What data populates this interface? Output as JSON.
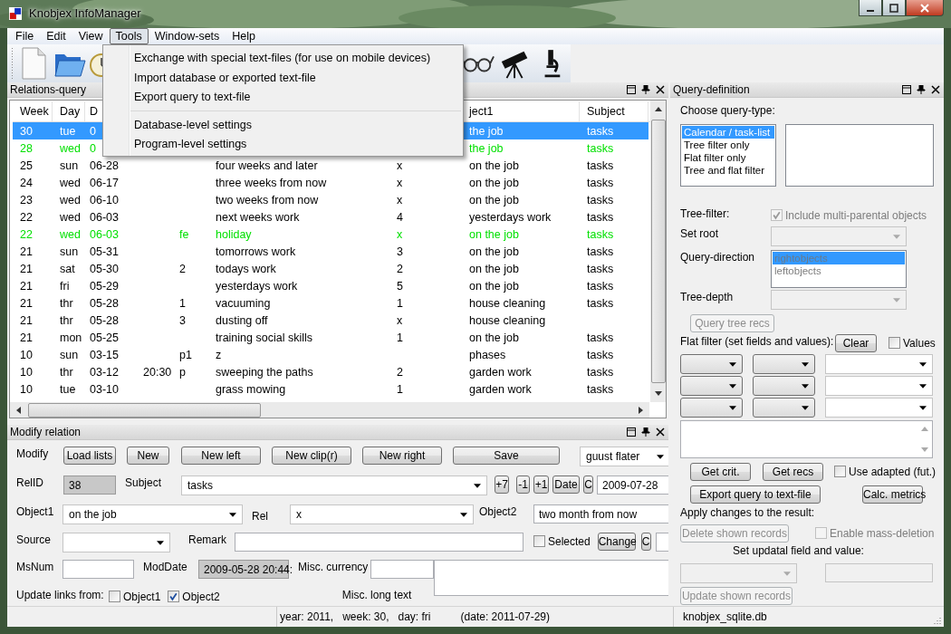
{
  "window": {
    "title": "Knobjex InfoManager"
  },
  "menu": [
    {
      "label": "File",
      "selected": false
    },
    {
      "label": "Edit",
      "selected": false
    },
    {
      "label": "View",
      "selected": false
    },
    {
      "label": "Tools",
      "selected": true
    },
    {
      "label": "Window-sets",
      "selected": false
    },
    {
      "label": "Help",
      "selected": false
    }
  ],
  "tools_menu": {
    "groups": [
      [
        "Exchange with special text-files (for use on mobile devices)",
        "Import database or exported text-file",
        "Export query to text-file"
      ],
      [
        "Database-level settings",
        "Program-level settings"
      ]
    ]
  },
  "relations_query": {
    "title": "Relations-query",
    "headers": {
      "week": "Week",
      "day": "Day",
      "date": "D",
      "object1": "ject1",
      "subject": "Subject"
    },
    "rows": [
      {
        "selected": true,
        "week": "30",
        "day": "tue",
        "date": "0",
        "object1": "the job",
        "subject": "tasks"
      },
      {
        "selected": false,
        "color": "#00e000",
        "week": "28",
        "day": "wed",
        "date": "0",
        "object1": "the job",
        "subject": "tasks"
      },
      {
        "selected": false,
        "color": "#000000",
        "week": "25",
        "day": "sun",
        "date": "06-28",
        "column_6": "four weeks and later",
        "column_7": "x",
        "object1": "on the job",
        "subject": "tasks"
      },
      {
        "selected": false,
        "color": "#000000",
        "week": "24",
        "day": "wed",
        "date": "06-17",
        "column_6": "three weeks from now",
        "column_7": "x",
        "object1": "on the job",
        "subject": "tasks"
      },
      {
        "selected": false,
        "color": "#000000",
        "week": "23",
        "day": "wed",
        "date": "06-10",
        "column_6": "two weeks from now",
        "column_7": "x",
        "object1": "on the job",
        "subject": "tasks"
      },
      {
        "selected": false,
        "color": "#000000",
        "week": "22",
        "day": "wed",
        "date": "06-03",
        "column_6": "next weeks work",
        "column_7": "4",
        "object1": "yesterdays work",
        "subject": "tasks"
      },
      {
        "selected": false,
        "color": "#00e000",
        "week": "22",
        "day": "wed",
        "date": "06-03",
        "column_5": "fe",
        "column_6": "holiday",
        "column_7": "x",
        "object1": "on the job",
        "subject": "tasks"
      },
      {
        "selected": false,
        "color": "#000000",
        "week": "21",
        "day": "sun",
        "date": "05-31",
        "column_6": "tomorrows work",
        "column_7": "3",
        "object1": "on the job",
        "subject": "tasks"
      },
      {
        "selected": false,
        "color": "#000000",
        "week": "21",
        "day": "sat",
        "date": "05-30",
        "column_5": "2",
        "column_6": "todays work",
        "column_7": "2",
        "object1": "on the job",
        "subject": "tasks"
      },
      {
        "selected": false,
        "color": "#000000",
        "week": "21",
        "day": "fri",
        "date": "05-29",
        "column_6": "yesterdays work",
        "column_7": "5",
        "object1": "on the job",
        "subject": "tasks"
      },
      {
        "selected": false,
        "color": "#000000",
        "week": "21",
        "day": "thr",
        "date": "05-28",
        "column_5": "1",
        "column_6": "vacuuming",
        "column_7": "1",
        "object1": "house cleaning",
        "subject": "tasks"
      },
      {
        "selected": false,
        "color": "#000000",
        "week": "21",
        "day": "thr",
        "date": "05-28",
        "column_5": "3",
        "column_6": "dusting off",
        "column_7": "x",
        "object1": "house cleaning"
      },
      {
        "selected": false,
        "color": "#000000",
        "week": "21",
        "day": "mon",
        "date": "05-25",
        "column_6": "training social skills",
        "column_7": "1",
        "object1": "on the job",
        "subject": "tasks"
      },
      {
        "selected": false,
        "color": "#000000",
        "week": "10",
        "day": "sun",
        "date": "03-15",
        "column_5": "p1",
        "column_6": "z",
        "object1": "phases",
        "subject": "tasks"
      },
      {
        "selected": false,
        "color": "#000000",
        "week": "10",
        "day": "thr",
        "date": "03-12",
        "column_4": "20:30",
        "column_5": "p",
        "column_6": "sweeping the paths",
        "column_7": "2",
        "object1": "garden work",
        "subject": "tasks"
      },
      {
        "selected": false,
        "color": "#000000",
        "week": "10",
        "day": "tue",
        "date": "03-10",
        "column_6": "grass mowing",
        "column_7": "1",
        "object1": "garden work",
        "subject": "tasks"
      }
    ]
  },
  "modify_relation": {
    "title": "Modify relation",
    "modify_label": "Modify",
    "buttons": [
      "Load lists",
      "New",
      "New left",
      "New clip(r)",
      "New right",
      "Save"
    ],
    "user": "guust flater",
    "relid_label": "RelID",
    "relid": {
      "value": "38",
      "readonly": true
    },
    "subject_label": "Subject",
    "subject": "tasks",
    "date_buttons": [
      "+7",
      "-1",
      "+1",
      "Date",
      "C"
    ],
    "date": "2009-07-28",
    "object1_label": "Object1",
    "object1": "on the job",
    "rel_label": "Rel",
    "rel": "x",
    "object2_label": "Object2",
    "object2": "two month from now",
    "source_label": "Source",
    "remark_label": "Remark",
    "selected_check": {
      "label": "Selected",
      "checked": false
    },
    "change_buttons": [
      "Change",
      "C"
    ],
    "msnum_label": "MsNum",
    "moddate_label": "ModDate",
    "moddate": {
      "value": "2009-05-28 20:44:",
      "readonly": true
    },
    "currency_label": "Misc. currency",
    "update_links_label": "Update links from:",
    "update_links": [
      {
        "label": "Object1",
        "checked": false
      },
      {
        "label": "Object2",
        "checked": true
      }
    ],
    "long_text_label": "Misc. long text"
  },
  "query_definition": {
    "title": "Query-definition",
    "choose_label": "Choose query-type:",
    "query_types": [
      {
        "label": "Calendar / task-list",
        "selected": true
      },
      {
        "label": "Tree filter only",
        "selected": false
      },
      {
        "label": "Flat filter only",
        "selected": false
      },
      {
        "label": "Tree and flat filter",
        "selected": false
      }
    ],
    "tree_filter_label": "Tree-filter:",
    "multi_parental": {
      "label": "Include multi-parental objects",
      "checked": true,
      "disabled": true
    },
    "set_root_label": "Set root",
    "direction_label": "Query-direction",
    "directions": [
      {
        "label": "rightobjects",
        "selected": true
      },
      {
        "label": "leftobjects",
        "selected": false
      }
    ],
    "tree_depth_label": "Tree-depth",
    "query_tree_button": {
      "label": "Query tree recs",
      "disabled": true
    },
    "flat_filter_label": "Flat filter (set fields and values):",
    "clear_button": {
      "label": "Clear",
      "disabled": false
    },
    "values_check": {
      "label": "Values",
      "checked": false,
      "disabled": false
    },
    "get_crit_button": {
      "label": "Get crit.",
      "disabled": false
    },
    "get_recs_button": {
      "label": "Get recs",
      "disabled": false
    },
    "use_adapted": {
      "label": "Use adapted (fut.)",
      "checked": false,
      "disabled": false
    },
    "export_button": {
      "label": "Export query to text-file",
      "disabled": false
    },
    "metrics_button": {
      "label": "Calc. metrics",
      "disabled": false
    },
    "apply_label": "Apply changes to the result:",
    "delete_button": {
      "label": "Delete shown records",
      "disabled": true
    },
    "mass_deletion": {
      "label": "Enable mass-deletion",
      "checked": false,
      "disabled": true
    },
    "set_update_label": "Set updatal field and value:",
    "update_button": {
      "label": "Update shown records",
      "disabled": true
    }
  },
  "status_bar": {
    "week_info": "year: 2011,   week: 30,   day: fri",
    "date_info": "(date: 2011-07-29)",
    "database": "knobjex_sqlite.db"
  }
}
